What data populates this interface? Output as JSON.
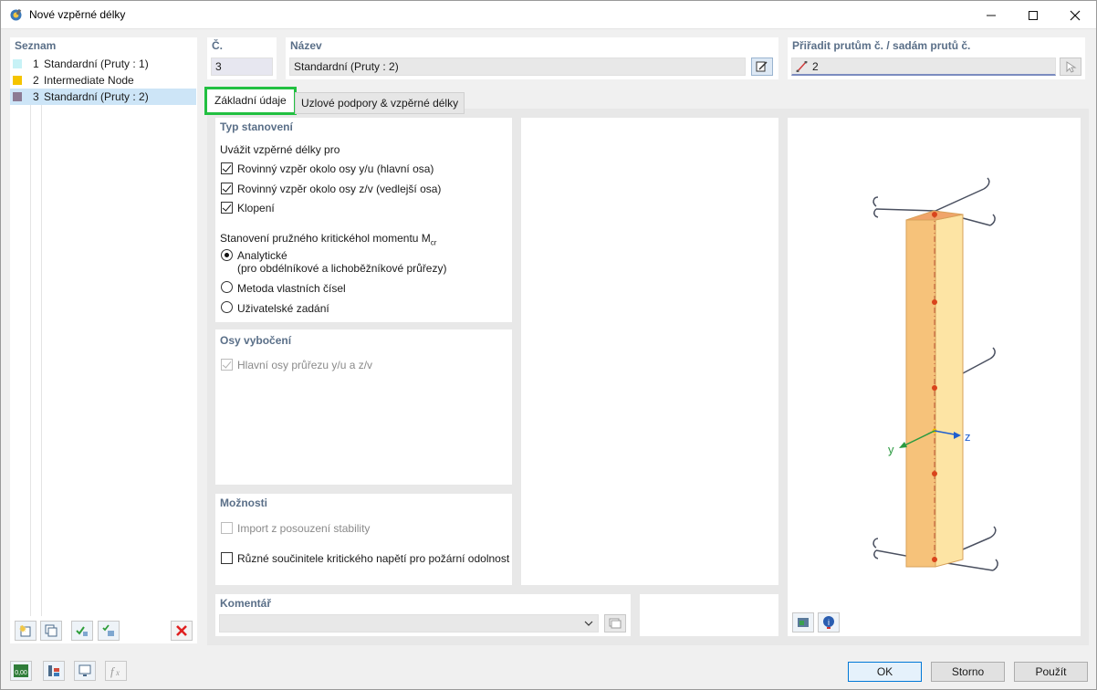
{
  "window": {
    "title": "Nové vzpěrné délky"
  },
  "list": {
    "title": "Seznam",
    "items": [
      {
        "num": "1",
        "label": "Standardní (Pruty : 1)",
        "color": "#c7f2f6",
        "selected": false
      },
      {
        "num": "2",
        "label": "Intermediate Node",
        "color": "#f5c400",
        "selected": false
      },
      {
        "num": "3",
        "label": "Standardní (Pruty : 2)",
        "color": "#8c7b94",
        "selected": true
      }
    ]
  },
  "number": {
    "label": "Č.",
    "value": "3"
  },
  "name": {
    "label": "Název",
    "value": "Standardní (Pruty : 2)"
  },
  "assign": {
    "label": "Přiřadit prutům č. / sadám prutů č.",
    "value": "2"
  },
  "tabs": [
    {
      "label": "Základní údaje",
      "active": true
    },
    {
      "label": "Uzlové podpory & vzpěrné délky",
      "active": false
    }
  ],
  "typ": {
    "title": "Typ stanovení",
    "consider_label": "Uvážit vzpěrné délky pro",
    "checks": [
      {
        "label": "Rovinný vzpěr okolo osy y/u (hlavní osa)",
        "checked": true
      },
      {
        "label": "Rovinný vzpěr okolo osy z/v (vedlejší osa)",
        "checked": true
      },
      {
        "label": "Klopení",
        "checked": true
      }
    ],
    "mcr_label": "Stanovení pružného kritickéhol momentu M",
    "mcr_sub": "cr",
    "radios": [
      {
        "label": "Analytické",
        "sub": "(pro obdélníkové a lichoběžníkové průřezy)",
        "checked": true
      },
      {
        "label": "Metoda vlastních čísel",
        "sub": "",
        "checked": false
      },
      {
        "label": "Uživatelské zadání",
        "sub": "",
        "checked": false
      }
    ]
  },
  "osy": {
    "title": "Osy vybočení",
    "check_label": "Hlavní osy průřezu y/u a z/v",
    "checked": true
  },
  "moznosti": {
    "title": "Možnosti",
    "import_label": "Import z posouzení stability",
    "fire_label": "Různé součinitele kritického napětí pro požární odolnost"
  },
  "komentar": {
    "label": "Komentář",
    "value": ""
  },
  "axes": {
    "y": "y",
    "z": "z"
  },
  "buttons": {
    "ok": "OK",
    "cancel": "Storno",
    "apply": "Použít"
  },
  "status": {
    "units_label": "0,00"
  },
  "colors": {
    "accent_green": "#22c041",
    "section_title": "#5a6f88",
    "beam": "#f8cf7f",
    "node": "#d9441c"
  }
}
